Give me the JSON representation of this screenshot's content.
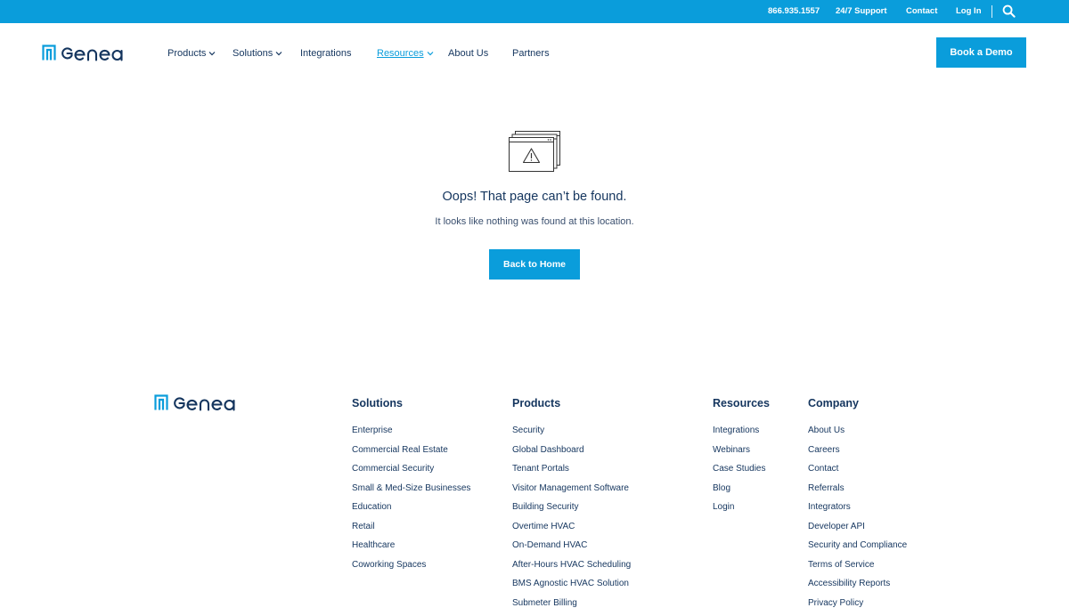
{
  "colors": {
    "accent": "#0a9ddb",
    "navy": "#14355e",
    "background": "#ffffff"
  },
  "topbar": {
    "phone": "866.935.1557",
    "support": "24/7 Support",
    "contact": "Contact",
    "login": "Log In",
    "search_icon": "search-icon"
  },
  "header": {
    "logo_text": "genea",
    "nav": [
      {
        "label": "Products",
        "has_dropdown": true
      },
      {
        "label": "Solutions",
        "has_dropdown": true
      },
      {
        "label": "Integrations",
        "has_dropdown": false
      },
      {
        "label": "Resources",
        "has_dropdown": true,
        "active": true
      },
      {
        "label": "About Us",
        "has_dropdown": false
      },
      {
        "label": "Partners",
        "has_dropdown": false
      }
    ],
    "cta": "Book a Demo"
  },
  "error": {
    "icon": "browser-warning-icon",
    "title": "Oops! That page can’t be found.",
    "message": "It looks like nothing was found at this location.",
    "button": "Back to Home"
  },
  "footer": {
    "logo_text": "genea",
    "columns": [
      {
        "title": "Solutions",
        "links": [
          "Enterprise",
          "Commercial Real Estate",
          "Commercial Security",
          "Small & Med-Size Businesses",
          "Education",
          "Retail",
          "Healthcare",
          "Coworking Spaces"
        ]
      },
      {
        "title": "Products",
        "links": [
          "Security",
          "Global Dashboard",
          "Tenant Portals",
          "Visitor Management Software",
          "Building Security",
          "Overtime HVAC",
          "On-Demand HVAC",
          "After-Hours HVAC Scheduling",
          "BMS Agnostic HVAC Solution",
          "Submeter Billing"
        ]
      },
      {
        "title": "Resources",
        "links": [
          "Integrations",
          "Webinars",
          "Case Studies",
          "Blog",
          "Login"
        ]
      },
      {
        "title": "Company",
        "links": [
          "About Us",
          "Careers",
          "Contact",
          "Referrals",
          "Integrators",
          "Developer API",
          "Security and Compliance",
          "Terms of Service",
          "Accessibility Reports",
          "Privacy Policy"
        ]
      }
    ]
  }
}
